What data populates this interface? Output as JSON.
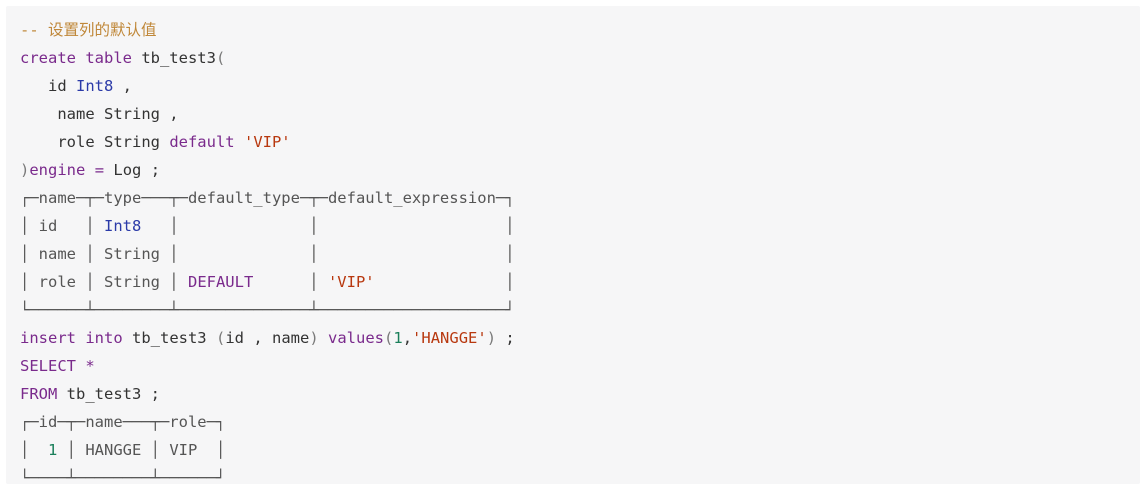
{
  "code": {
    "lines": [
      [
        {
          "t": "-- 设置列的默认值",
          "k": "comment"
        }
      ],
      [
        {
          "t": "create table",
          "k": "kw"
        },
        {
          "t": " tb_test3",
          "k": "plain"
        },
        {
          "t": "(",
          "k": "punct"
        }
      ],
      [
        {
          "t": "   id ",
          "k": "plain"
        },
        {
          "t": "Int8",
          "k": "type"
        },
        {
          "t": " ,",
          "k": "plain"
        }
      ],
      [
        {
          "t": "    name String ,",
          "k": "plain"
        }
      ],
      [
        {
          "t": "    role String ",
          "k": "plain"
        },
        {
          "t": "default",
          "k": "kw"
        },
        {
          "t": " ",
          "k": "plain"
        },
        {
          "t": "'VIP'",
          "k": "str"
        }
      ],
      [
        {
          "t": ")",
          "k": "punct"
        },
        {
          "t": "engine",
          "k": "kw"
        },
        {
          "t": " ",
          "k": "plain"
        },
        {
          "t": "=",
          "k": "kw"
        },
        {
          "t": " Log ;",
          "k": "plain"
        }
      ],
      [
        {
          "t": "┌─name─┬─type───┬─default_type─┬─default_expression─┐",
          "k": "box"
        }
      ],
      [
        {
          "t": "│ id   │ ",
          "k": "box"
        },
        {
          "t": "Int8",
          "k": "type"
        },
        {
          "t": "   │              │                    │",
          "k": "box"
        }
      ],
      [
        {
          "t": "│ name │ String │              │                    │",
          "k": "box"
        }
      ],
      [
        {
          "t": "│ role │ String │ ",
          "k": "box"
        },
        {
          "t": "DEFAULT",
          "k": "kw"
        },
        {
          "t": "      │ ",
          "k": "box"
        },
        {
          "t": "'VIP'",
          "k": "str"
        },
        {
          "t": "              │",
          "k": "box"
        }
      ],
      [
        {
          "t": "└──────┴────────┴──────────────┴────────────────────┘",
          "k": "box"
        }
      ],
      [
        {
          "t": "insert into",
          "k": "kw"
        },
        {
          "t": " tb_test3 ",
          "k": "plain"
        },
        {
          "t": "(",
          "k": "punct"
        },
        {
          "t": "id , name",
          "k": "plain"
        },
        {
          "t": ")",
          "k": "punct"
        },
        {
          "t": " ",
          "k": "plain"
        },
        {
          "t": "values",
          "k": "kw"
        },
        {
          "t": "(",
          "k": "punct"
        },
        {
          "t": "1",
          "k": "num"
        },
        {
          "t": ",",
          "k": "plain"
        },
        {
          "t": "'HANGGE'",
          "k": "str"
        },
        {
          "t": ")",
          "k": "punct"
        },
        {
          "t": " ;",
          "k": "plain"
        }
      ],
      [
        {
          "t": "SELECT",
          "k": "kw"
        },
        {
          "t": " ",
          "k": "plain"
        },
        {
          "t": "*",
          "k": "kw"
        }
      ],
      [
        {
          "t": "FROM",
          "k": "kw"
        },
        {
          "t": " tb_test3 ;",
          "k": "plain"
        }
      ],
      [
        {
          "t": "┌─id─┬─name───┬─role─┐",
          "k": "box"
        }
      ],
      [
        {
          "t": "│  ",
          "k": "box"
        },
        {
          "t": "1",
          "k": "num"
        },
        {
          "t": " │ HANGGE │ VIP  │",
          "k": "box"
        }
      ],
      [
        {
          "t": "└────┴────────┴──────┘",
          "k": "box"
        }
      ]
    ],
    "colors": {
      "comment": "#c0883a",
      "keyword": "#7a2a8c",
      "type": "#2b3aa8",
      "string": "#b8380f",
      "number": "#1a7f5a",
      "text": "#333333",
      "background": "#f6f6f7"
    }
  }
}
